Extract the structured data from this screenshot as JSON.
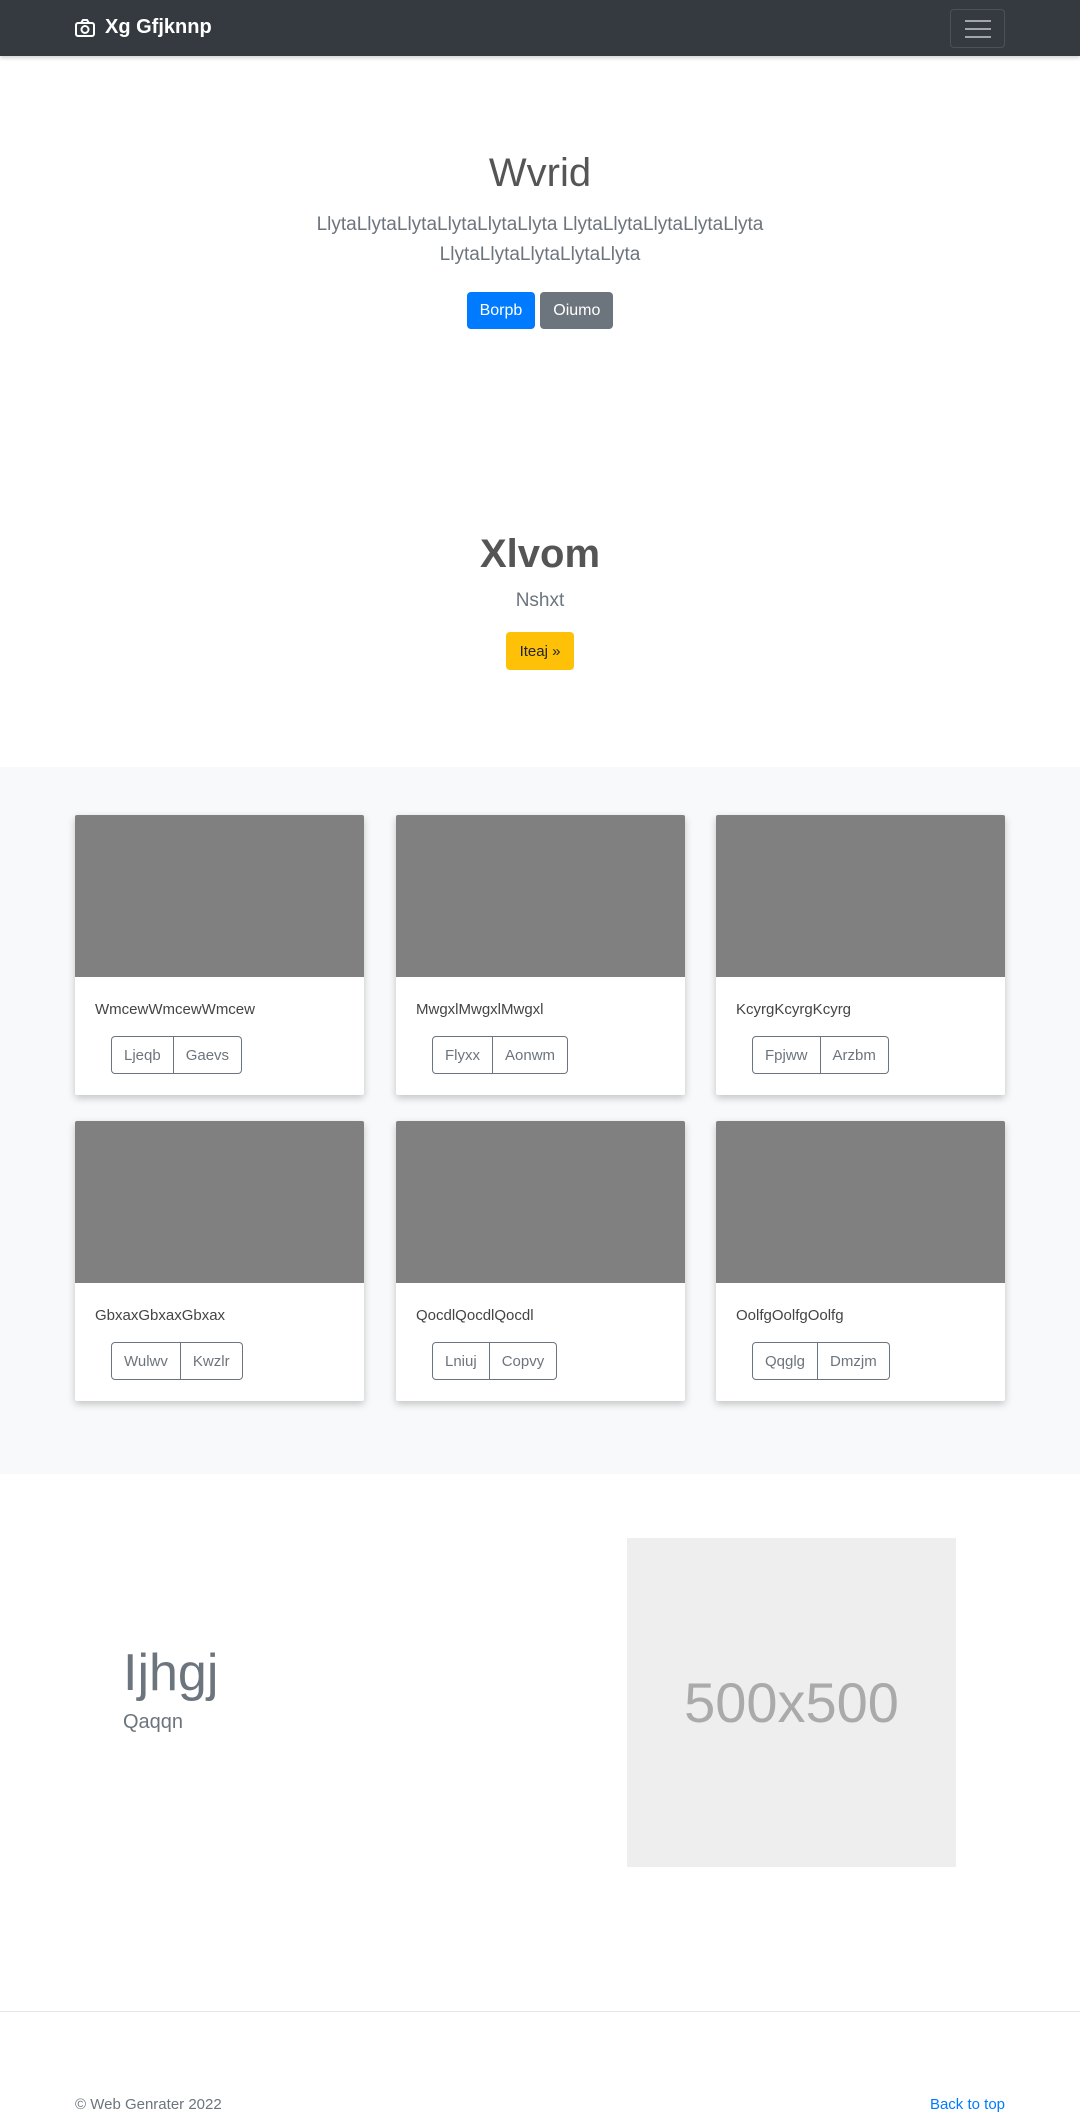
{
  "navbar": {
    "brand": "Xg Gfjknnp"
  },
  "hero": {
    "title": "Wvrid",
    "lead": "LlytaLlytaLlytaLlytaLlytaLlyta LlytaLlytaLlytaLlytaLlyta LlytaLlytaLlytaLlytaLlyta",
    "primary_button": "Borpb",
    "secondary_button": "Oiumo"
  },
  "jumbotron": {
    "title": "Xlvom",
    "subtitle": "Nshxt",
    "button": "Iteaj »"
  },
  "cards": [
    {
      "text": "WmcewWmcewWmcew",
      "btn1": "Ljeqb",
      "btn2": "Gaevs"
    },
    {
      "text": "MwgxlMwgxlMwgxl",
      "btn1": "Flyxx",
      "btn2": "Aonwm"
    },
    {
      "text": "KcyrgKcyrgKcyrg",
      "btn1": "Fpjww",
      "btn2": "Arzbm"
    },
    {
      "text": "GbxaxGbxaxGbxax",
      "btn1": "Wulwv",
      "btn2": "Kwzlr"
    },
    {
      "text": "QocdlQocdlQocdl",
      "btn1": "Lniuj",
      "btn2": "Copvy"
    },
    {
      "text": "OolfgOolfgOolfg",
      "btn1": "Qqglg",
      "btn2": "Dmzjm"
    }
  ],
  "feature": {
    "heading": "Ijhgj",
    "subheading": "Qaqqn",
    "placeholder": "500x500"
  },
  "footer": {
    "copyright": "© Web Genrater 2022",
    "back_to_top": "Back to top"
  }
}
